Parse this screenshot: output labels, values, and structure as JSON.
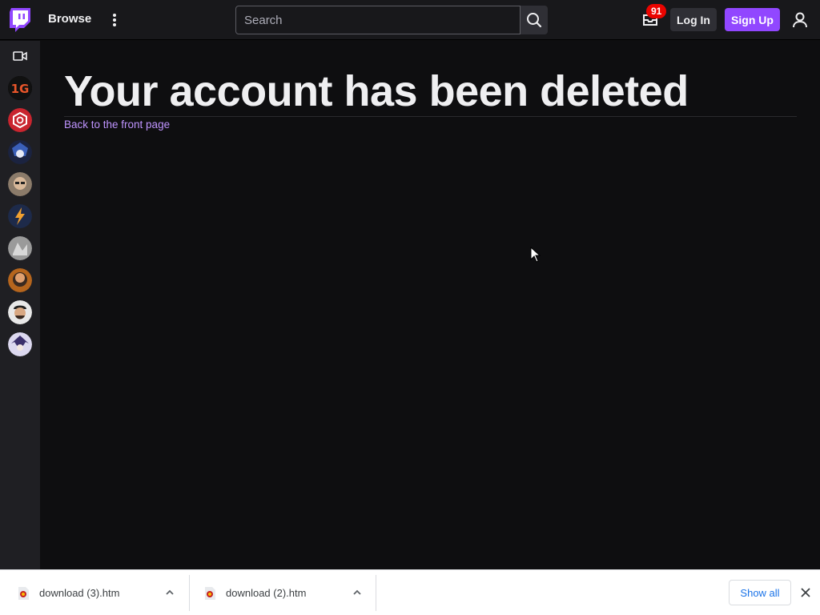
{
  "nav": {
    "browse_label": "Browse",
    "search_placeholder": "Search",
    "notification_count": "91",
    "login_label": "Log In",
    "signup_label": "Sign Up"
  },
  "sidebar": {
    "items": [
      {
        "icon": "video-camera-icon"
      },
      {
        "avatar": "channel-avatar-1g"
      },
      {
        "avatar": "channel-avatar-red-logo"
      },
      {
        "avatar": "channel-avatar-anime-blue"
      },
      {
        "avatar": "channel-avatar-person-glasses"
      },
      {
        "avatar": "channel-avatar-lightning"
      },
      {
        "avatar": "channel-avatar-grey"
      },
      {
        "avatar": "channel-avatar-bearded"
      },
      {
        "avatar": "channel-avatar-cap-person"
      },
      {
        "avatar": "channel-avatar-anime-purple"
      }
    ]
  },
  "main": {
    "heading": "Your account has been deleted",
    "back_link": "Back to the front page"
  },
  "downloads": {
    "items": [
      {
        "name": "download (3).htm"
      },
      {
        "name": "download (2).htm"
      }
    ],
    "show_all": "Show all"
  },
  "colors": {
    "accent": "#9147ff",
    "link": "#bf94ff",
    "badge": "#eb0400",
    "background": "#0e0e10"
  }
}
